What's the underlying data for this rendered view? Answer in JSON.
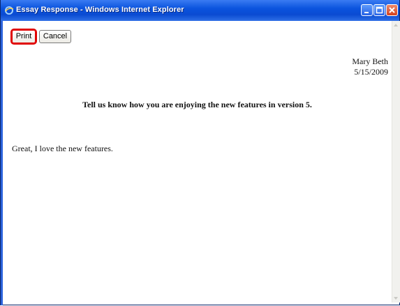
{
  "window": {
    "title": "Essay Response - Windows Internet Explorer",
    "icon": "ie-icon",
    "controls": [
      "minimize-icon",
      "maximize-icon",
      "close-icon"
    ]
  },
  "toolbar": {
    "print_label": "Print",
    "cancel_label": "Cancel"
  },
  "response": {
    "author": "Mary Beth",
    "date": "5/15/2009",
    "question": "Tell us know how you are enjoying the new features in version 5.",
    "answer": "Great, I love the new features."
  },
  "colors": {
    "titlebar": "#0b54de",
    "print_highlight": "#e00000"
  }
}
